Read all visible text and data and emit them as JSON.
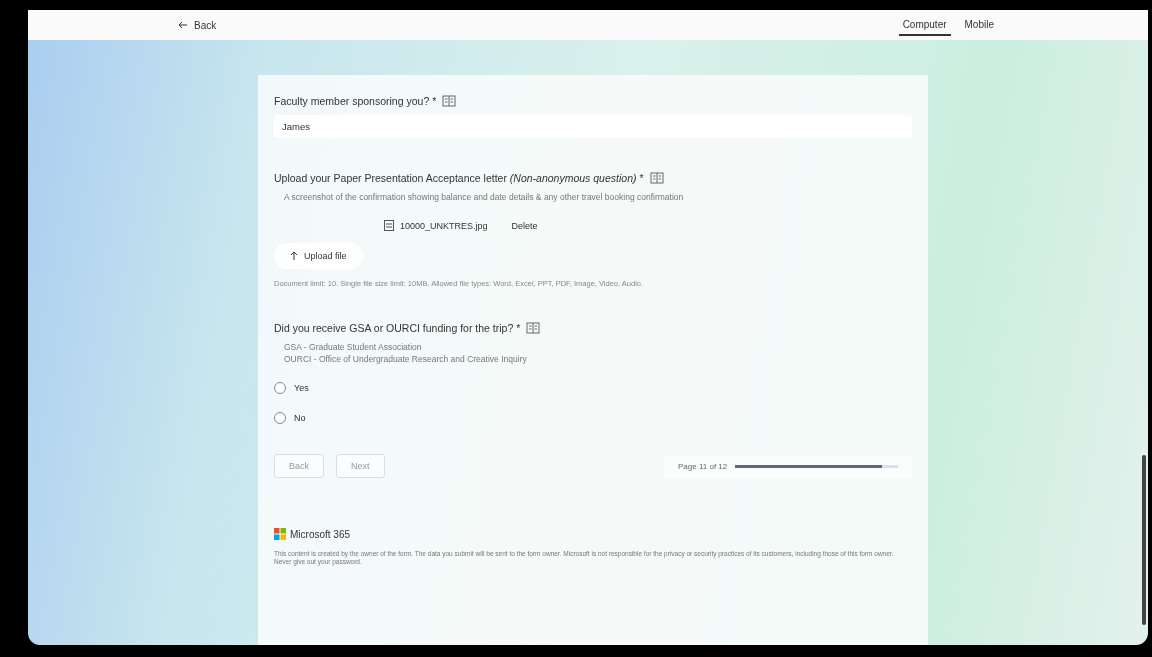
{
  "top_bar": {
    "back": "Back",
    "views": [
      {
        "label": "Computer",
        "selected": true
      },
      {
        "label": "Mobile",
        "selected": false
      }
    ]
  },
  "questions": [
    {
      "kind": "text",
      "title": "Faculty member sponsoring you? *",
      "value": "James"
    },
    {
      "kind": "upload",
      "title": "Upload your Paper Presentation Acceptance letter",
      "note": "(Non-anonymous question)",
      "after": " *",
      "subtitle": "A screenshot of the confirmation showing balance and date details & any other travel booking confirmation",
      "file": {
        "name": "10000_UNKTRES.jpg",
        "action": "Delete"
      },
      "button": "Upload file",
      "limits": "Document limit: 10. Single file size limit: 10MB. Allowed file types: Word, Excel, PPT, PDF, Image, Video, Audio."
    },
    {
      "kind": "choice",
      "title": "Did you receive GSA or OURCI funding for the trip? *",
      "subtitle_lines": [
        "GSA - Graduate Student Association",
        "OURCI - Office of Undergraduate Research and Creative Inquiry"
      ],
      "options": [
        {
          "label": "Yes",
          "selected": false
        },
        {
          "label": "No",
          "selected": false
        }
      ]
    }
  ],
  "nav": {
    "buttons": [
      "Back",
      "Next"
    ],
    "progress_text": "Page 11 of 12",
    "level": 0.9
  },
  "footer": {
    "brand": "Microsoft 365",
    "disclaimer": "This content is created by the owner of the form. The data you submit will be sent to the form owner. Microsoft is not responsible for the privacy or security practices of its customers, including those of this form owner. Never give out your password."
  }
}
